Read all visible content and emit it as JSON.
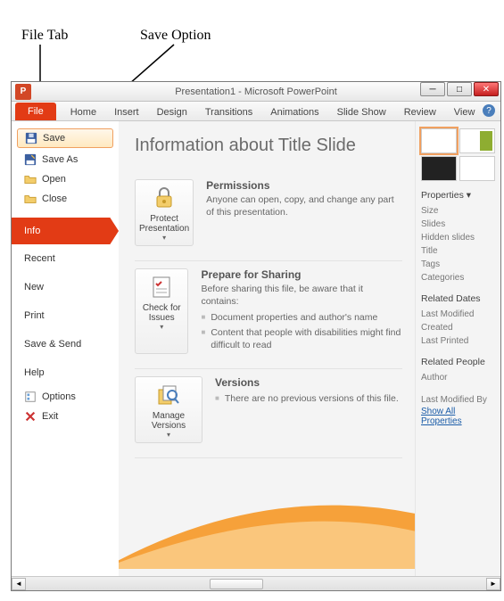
{
  "annotations": {
    "file_tab": "File Tab",
    "save_option": "Save Option"
  },
  "titlebar": {
    "title": "Presentation1 - Microsoft PowerPoint"
  },
  "tabs": {
    "file": "File",
    "home": "Home",
    "insert": "Insert",
    "design": "Design",
    "transitions": "Transitions",
    "animations": "Animations",
    "slideshow": "Slide Show",
    "review": "Review",
    "view": "View"
  },
  "left": {
    "save": "Save",
    "save_as": "Save As",
    "open": "Open",
    "close": "Close",
    "info": "Info",
    "recent": "Recent",
    "new": "New",
    "print": "Print",
    "save_send": "Save & Send",
    "help": "Help",
    "options": "Options",
    "exit": "Exit"
  },
  "main": {
    "heading": "Information about Title Slide",
    "permissions": {
      "btn": "Protect Presentation",
      "title": "Permissions",
      "body": "Anyone can open, copy, and change any part of this presentation."
    },
    "prepare": {
      "btn": "Check for Issues",
      "title": "Prepare for Sharing",
      "intro": "Before sharing this file, be aware that it contains:",
      "bullet1": "Document properties and author's name",
      "bullet2": "Content that people with disabilities might find difficult to read"
    },
    "versions": {
      "btn": "Manage Versions",
      "title": "Versions",
      "bullet1": "There are no previous versions of this file."
    }
  },
  "right": {
    "properties_label": "Properties",
    "items": {
      "size": "Size",
      "slides": "Slides",
      "hidden": "Hidden slides",
      "title": "Title",
      "tags": "Tags",
      "categories": "Categories"
    },
    "related_dates": "Related Dates",
    "dates": {
      "modified": "Last Modified",
      "created": "Created",
      "printed": "Last Printed"
    },
    "related_people": "Related People",
    "author": "Author",
    "last_mod_by": "Last Modified By",
    "show_all": "Show All Properties"
  }
}
